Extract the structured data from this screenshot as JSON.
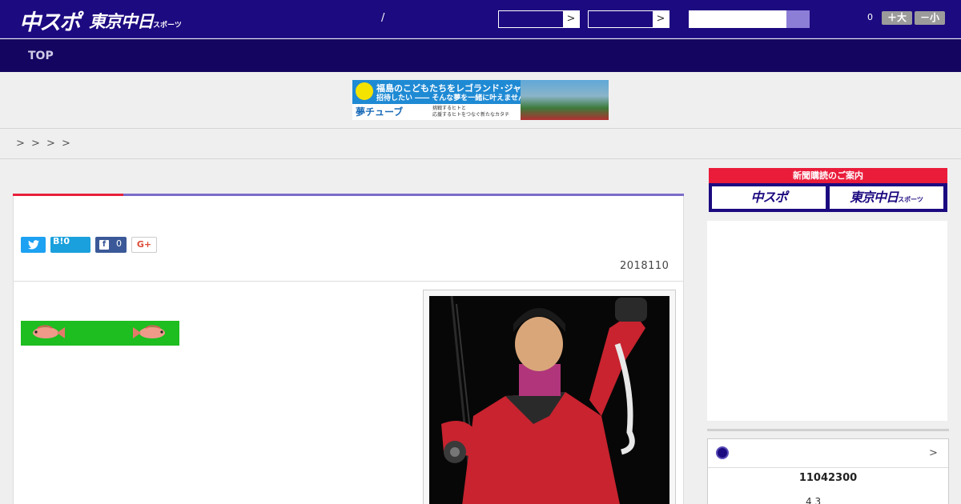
{
  "header": {
    "logo_chuspo": "中スポ",
    "logo_tokyo": "東京中日",
    "logo_tokyo_small": "スポーツ",
    "separator": "/",
    "select_arrow": ">",
    "font_size_count": "0",
    "font_bigger_label": "＋大",
    "font_smaller_label": "－小"
  },
  "nav": {
    "top_label": "TOP"
  },
  "banner": {
    "line1": "福島のこどもたちをレゴランド･ジャパンに",
    "line2": "招待したい ―― そんな夢を一緒に叶えませんか?",
    "brand": "夢チューブ",
    "desc1": "挑戦するヒトと",
    "desc2": "応援するヒトをつなぐ新たなカタチ"
  },
  "breadcrumb": {
    "separators": [
      ">",
      ">",
      ">",
      ">"
    ]
  },
  "article": {
    "share_twitter_icon": "twitter-icon",
    "share_hatena": "B!0",
    "share_facebook_count": "0",
    "share_google": "G+",
    "date": "2018110"
  },
  "sidebar": {
    "subscribe_header": "新聞購読のご案内",
    "subscribe_chuspo": "中スポ",
    "subscribe_tokyo": "東京中日",
    "subscribe_tokyo_small": "スポーツ",
    "score_arrow": ">",
    "score_main": "11042300",
    "score_sub": "4  3"
  },
  "colors": {
    "header_bg": "#1c0a80",
    "nav_bg": "#140560",
    "accent_red": "#e8203a",
    "accent_purple": "#7b6cc8",
    "fish_banner_green": "#1ebd20"
  }
}
